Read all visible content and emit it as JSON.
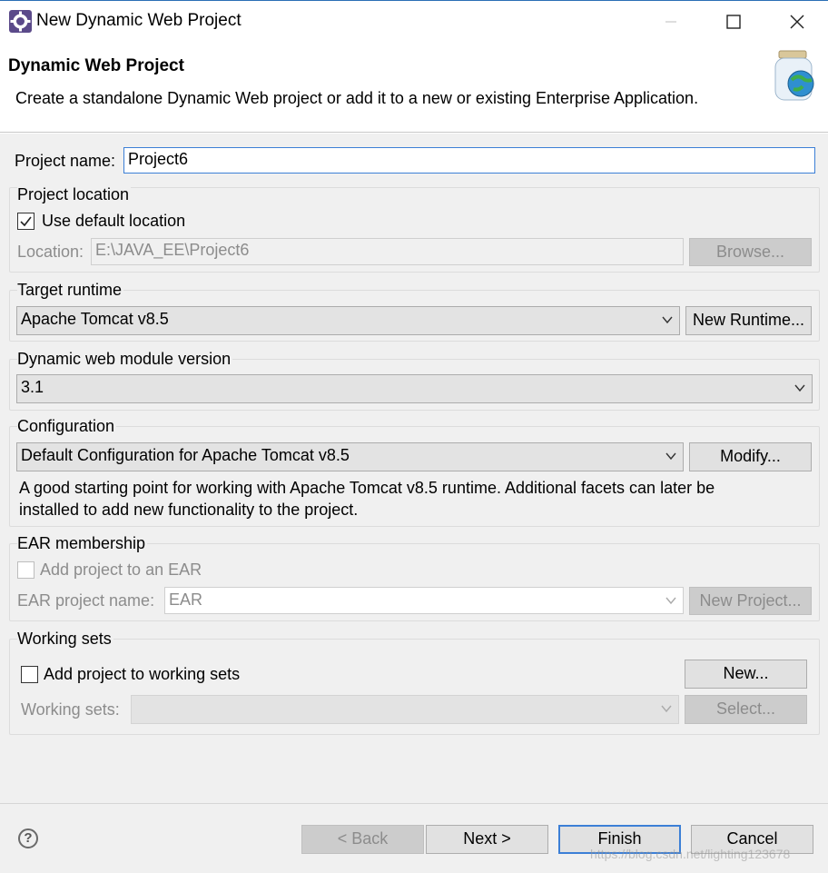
{
  "window": {
    "title": "New Dynamic Web Project",
    "app_icon": "eclipse-gear-icon"
  },
  "banner": {
    "heading": "Dynamic Web Project",
    "description": "Create a standalone Dynamic Web project or add it to a new or existing Enterprise Application.",
    "image": "web-project-jar-globe-icon"
  },
  "project_name": {
    "label": "Project name:",
    "value": "Project6"
  },
  "project_location": {
    "group_label": "Project location",
    "use_default_label": "Use default location",
    "use_default_checked": true,
    "location_label": "Location:",
    "location_value": "E:\\JAVA_EE\\Project6",
    "browse_label": "Browse..."
  },
  "target_runtime": {
    "group_label": "Target runtime",
    "selected": "Apache Tomcat v8.5",
    "new_runtime_label": "New Runtime..."
  },
  "module_version": {
    "group_label": "Dynamic web module version",
    "selected": "3.1"
  },
  "configuration": {
    "group_label": "Configuration",
    "selected": "Default Configuration for Apache Tomcat v8.5",
    "modify_label": "Modify...",
    "description_line1": "A good starting point for working with Apache Tomcat v8.5 runtime. Additional facets can later be",
    "description_line2": "installed to add new functionality to the project."
  },
  "ear_membership": {
    "group_label": "EAR membership",
    "add_label": "Add project to an EAR",
    "add_checked": false,
    "ear_name_label": "EAR project name:",
    "ear_name_value": "EAR",
    "new_project_label": "New Project..."
  },
  "working_sets": {
    "group_label": "Working sets",
    "add_label": "Add project to working sets",
    "add_checked": false,
    "new_label": "New...",
    "sets_label": "Working sets:",
    "select_label": "Select..."
  },
  "footer": {
    "help_icon": "help-question-icon",
    "back_label": "< Back",
    "next_label": "Next >",
    "finish_label": "Finish",
    "cancel_label": "Cancel",
    "watermark": "https://blog.csdn.net/lighting123678"
  }
}
